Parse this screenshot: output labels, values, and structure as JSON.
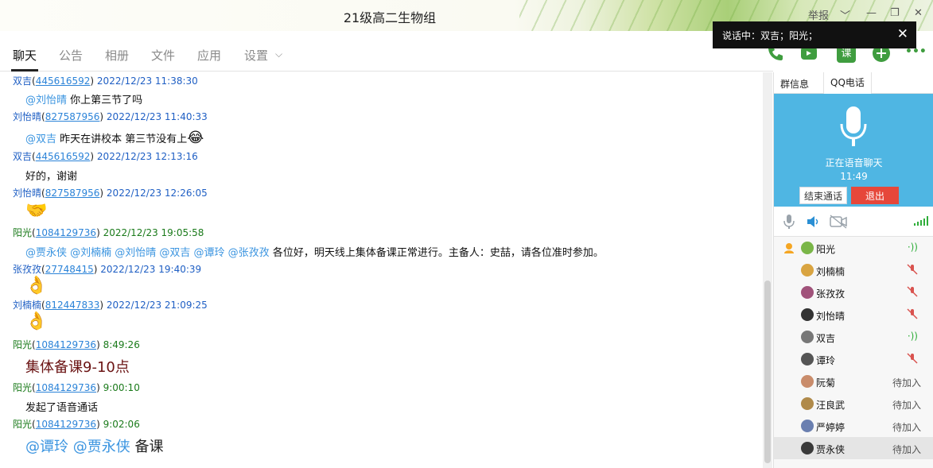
{
  "window": {
    "title": "21级高二生物组",
    "controls": [
      "举报",
      "﹀",
      "—",
      "❐",
      "✕"
    ]
  },
  "toast": {
    "text": "说话中：双吉；阳光；",
    "close": "✕"
  },
  "tabs": [
    "聊天",
    "公告",
    "相册",
    "文件",
    "应用",
    "设置"
  ],
  "tab_dropdown": "⌵",
  "toolbar_icons": [
    "phone-icon",
    "video-icon",
    "lesson-icon",
    "add-icon",
    "more-icon"
  ],
  "lesson_label": "课",
  "more_label": "•••",
  "messages": [
    {
      "name": "双吉",
      "qq": "445616592",
      "time": "2022/12/23 11:38:30",
      "text": "你上第三节了吗",
      "at": "@刘怡晴"
    },
    {
      "name": "刘怡晴",
      "qq": "827587956",
      "time": "2022/12/23 11:40:33",
      "text": "昨天在讲校本 第三节没有上",
      "at": "@双吉",
      "emoji": "😂"
    },
    {
      "name": "双吉",
      "qq": "445616592",
      "time": "2022/12/23 12:13:16",
      "text": "好的，谢谢"
    },
    {
      "name": "刘怡晴",
      "qq": "827587956",
      "time": "2022/12/23 12:26:05",
      "emoji": "🤝"
    },
    {
      "name": "阳光",
      "qq": "1084129736",
      "time": "2022/12/23 19:05:58",
      "at": "@贾永侠 @刘楠楠 @刘怡晴 @双吉 @谭玲 @张孜孜",
      "text": "各位好，明天线上集体备课正常进行。主备人：史喆，请各位准时参加。"
    },
    {
      "name": "张孜孜",
      "qq": "27748415",
      "time": "2022/12/23 19:40:39",
      "emoji": "👌"
    },
    {
      "name": "刘楠楠",
      "qq": "812447833",
      "time": "2022/12/23 21:09:25",
      "emoji": "👌"
    },
    {
      "name": "阳光",
      "qq": "1084129736",
      "time": "8:49:26",
      "text": "集体备课9-10点"
    },
    {
      "name": "阳光",
      "qq": "1084129736",
      "time": "9:00:10",
      "text": "发起了语音通话"
    },
    {
      "name": "阳光",
      "qq": "1084129736",
      "time": "9:02:06",
      "at": "@谭玲 @贾永侠",
      "text": "备课"
    }
  ],
  "right_tabs": [
    "群信息",
    "QQ电话"
  ],
  "voice": {
    "status": "正在语音聊天",
    "timer": "11:49",
    "end_label": "结束通话",
    "exit_label": "退出"
  },
  "members": [
    {
      "name": "阳光",
      "state": "speaking"
    },
    {
      "name": "刘楠楠",
      "state": "muted"
    },
    {
      "name": "张孜孜",
      "state": "muted"
    },
    {
      "name": "刘怡晴",
      "state": "muted"
    },
    {
      "name": "双吉",
      "state": "speaking"
    },
    {
      "name": "谭玲",
      "state": "muted"
    },
    {
      "name": "阮菊",
      "state": "待加入"
    },
    {
      "name": "汪良武",
      "state": "待加入"
    },
    {
      "name": "严婷婷",
      "state": "待加入"
    },
    {
      "name": "贾永侠",
      "state": "待加入"
    }
  ],
  "colors": {
    "accent": "#4fb6e3",
    "exit": "#e6473a",
    "qq_link": "#2b83d8",
    "at": "#3a94e0",
    "green_sender": "#1a7a1a"
  }
}
